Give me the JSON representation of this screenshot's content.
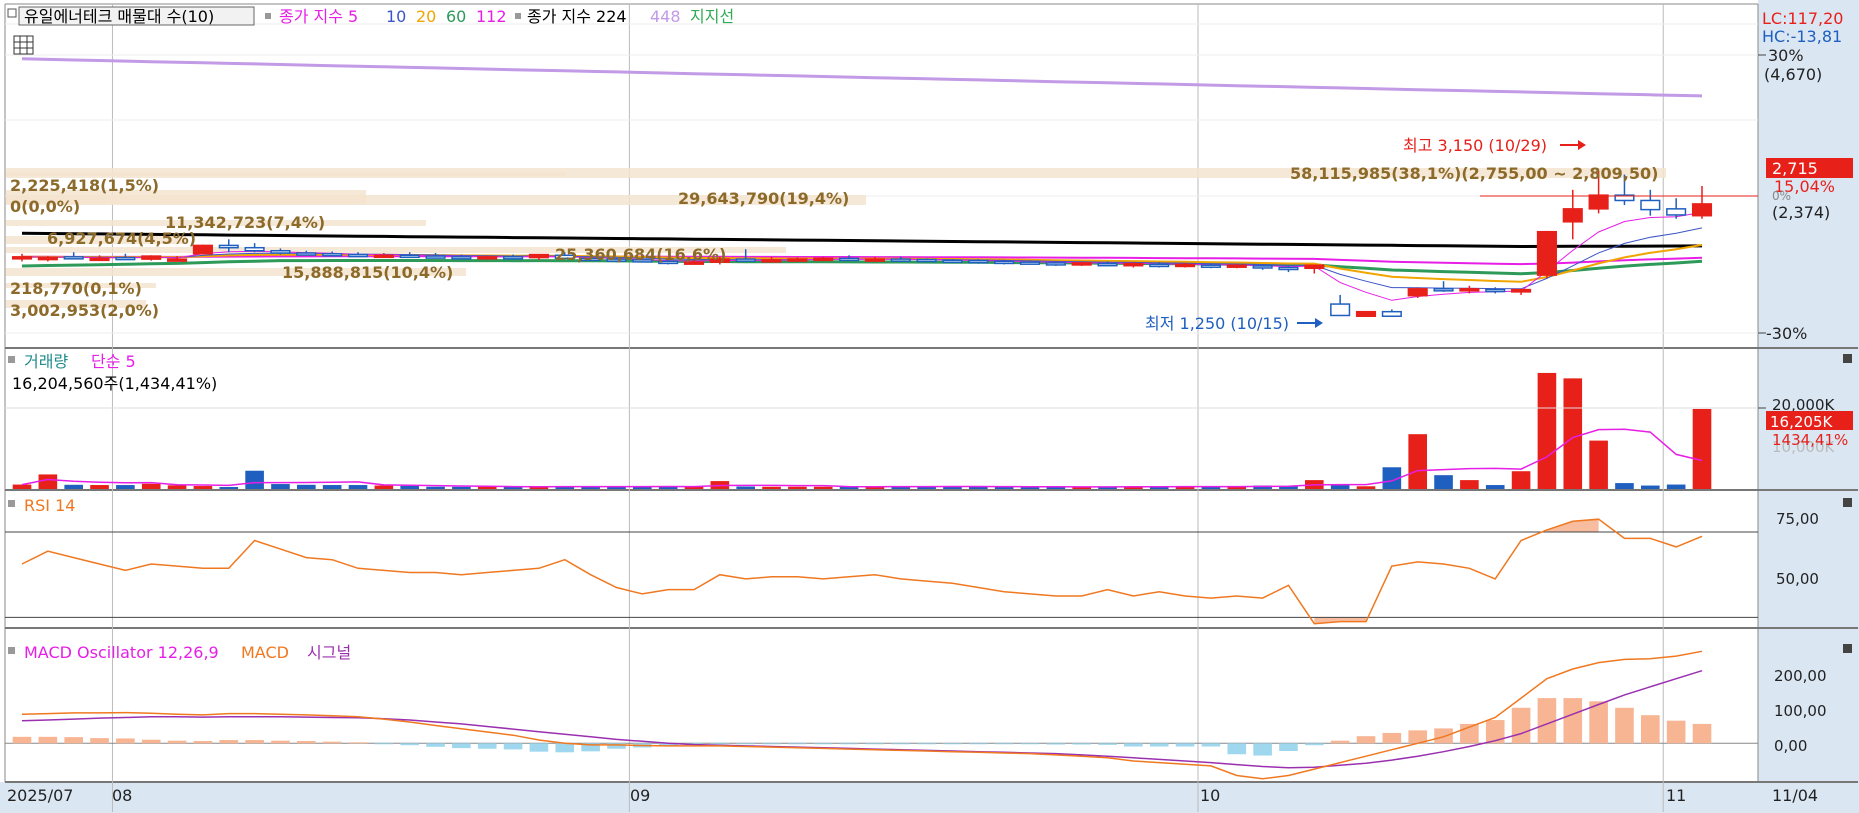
{
  "colors": {
    "up": "#e8201a",
    "down": "#1f5fbf",
    "ma5": "#e61ee6",
    "ma10": "#3b54c8",
    "ma20": "#f0a500",
    "ma60": "#2e9a5a",
    "ma112": "#e61ee6",
    "ma224": "#000000",
    "ma448": "#c29ae6",
    "support": "#33aa55",
    "volume_ma": "#e61ee6",
    "rsi": "#f07820",
    "macd": "#f07820",
    "signal": "#9a30b0",
    "osc_pos": "#f7b593",
    "osc_neg": "#9fd8ee",
    "volprofile_text": "#8c6a2a",
    "axis_bg": "#dbe6f3"
  },
  "legend": {
    "title": "유일에너테크 매물대 수(10)",
    "ma_label": "종가 지수 5",
    "ma10": "10",
    "ma20": "20",
    "ma60": "60",
    "ma112": "112",
    "ma2_label": "종가 지수 224",
    "ma448": "448",
    "support": "지지선"
  },
  "price_axis": {
    "lc": "LC:117,20",
    "hc": "HC:-13,81",
    "top_pct": "30%",
    "top_price": "(4,670)",
    "last_price": "2,715",
    "last_pct": "15,04%",
    "zero_pct": "0%",
    "base_price": "(2,374)",
    "bottom_pct": "-30%"
  },
  "price_annotations": {
    "high": "최고 3,150 (10/29)",
    "low": "최저 1,250 (10/15)"
  },
  "volume_profile": [
    {
      "text": "2,225,418(1,5%)"
    },
    {
      "text": "0(0,0%)"
    },
    {
      "text": "6,927,674(4,5%)"
    },
    {
      "text": "11,342,723(7,4%)"
    },
    {
      "text": "29,643,790(19,4%)"
    },
    {
      "text": "58,115,985(38,1%)(2,755,00 ~ 2,809,50)"
    },
    {
      "text": "25,360,684(16,6%)"
    },
    {
      "text": "15,888,815(10,4%)"
    },
    {
      "text": "218,770(0,1%)"
    },
    {
      "text": "3,002,953(2,0%)"
    }
  ],
  "volume_panel": {
    "title": "거래량",
    "ma_label": "단순 5",
    "summary": "16,204,560주(1,434,41%)",
    "axis_20000": "20,000K",
    "axis_last": "16,205K",
    "axis_pct": "1434,41%",
    "axis_hidden": "10,000K"
  },
  "rsi_panel": {
    "title": "RSI 14",
    "tick_75": "75,00",
    "tick_50": "50,00"
  },
  "macd_panel": {
    "osc_label": "MACD Oscillator 12,26,9",
    "macd_label": "MACD",
    "signal_label": "시그널",
    "tick_200": "200,00",
    "tick_100": "100,00",
    "tick_0": "0,00"
  },
  "x_axis": {
    "labels": [
      "2025/07",
      "08",
      "09",
      "10",
      "11"
    ],
    "right_label": "11/04"
  },
  "chart_data": {
    "type": "candlestick",
    "title": "유일에너테크",
    "dates": [
      "07/28",
      "07/29",
      "07/30",
      "07/31",
      "08/01",
      "08/04",
      "08/05",
      "08/06",
      "08/07",
      "08/08",
      "08/11",
      "08/12",
      "08/13",
      "08/14",
      "08/18",
      "08/19",
      "08/20",
      "08/21",
      "08/22",
      "08/25",
      "08/26",
      "08/27",
      "08/28",
      "08/29",
      "09/01",
      "09/02",
      "09/03",
      "09/04",
      "09/05",
      "09/08",
      "09/09",
      "09/10",
      "09/11",
      "09/12",
      "09/15",
      "09/16",
      "09/17",
      "09/18",
      "09/19",
      "09/22",
      "09/23",
      "09/24",
      "09/25",
      "09/26",
      "09/29",
      "09/30",
      "10/01",
      "10/02",
      "10/10",
      "10/13",
      "10/14",
      "10/15",
      "10/16",
      "10/17",
      "10/20",
      "10/21",
      "10/22",
      "10/23",
      "10/24",
      "10/27",
      "10/28",
      "10/29",
      "10/30",
      "10/31",
      "11/03",
      "11/04"
    ],
    "open": [
      2010,
      2000,
      2020,
      2000,
      2010,
      1990,
      1990,
      2060,
      2170,
      2140,
      2100,
      2070,
      2060,
      2050,
      2030,
      2040,
      2030,
      2020,
      2010,
      2020,
      2010,
      2040,
      2000,
      1990,
      1980,
      1960,
      1940,
      1950,
      1990,
      1980,
      1980,
      1990,
      2000,
      1990,
      1990,
      1985,
      1975,
      1970,
      1960,
      1950,
      1940,
      1930,
      1930,
      1920,
      1920,
      1910,
      1910,
      1900,
      1900,
      1880,
      1870,
      1400,
      1240,
      1300,
      1510,
      1600,
      1590,
      1590,
      1560,
      1780,
      2480,
      2650,
      2830,
      2760,
      2650,
      2560
    ],
    "high": [
      2060,
      2030,
      2080,
      2040,
      2060,
      2040,
      2030,
      2180,
      2250,
      2200,
      2130,
      2100,
      2090,
      2080,
      2070,
      2080,
      2070,
      2050,
      2040,
      2050,
      2040,
      2080,
      2030,
      2010,
      2000,
      2000,
      1980,
      2020,
      2120,
      2020,
      2010,
      2020,
      2040,
      2020,
      2020,
      2000,
      1990,
      1990,
      1980,
      1970,
      1960,
      1950,
      1960,
      1950,
      1950,
      1940,
      1930,
      1920,
      1920,
      1900,
      1910,
      1520,
      1300,
      1330,
      1620,
      1700,
      1640,
      1620,
      1600,
      2360,
      2900,
      3150,
      3100,
      2900,
      2790,
      2950
    ],
    "low": [
      1960,
      1960,
      1990,
      1980,
      1980,
      1970,
      1970,
      2050,
      2080,
      2080,
      2050,
      2040,
      2030,
      2020,
      2010,
      2010,
      2000,
      1990,
      1980,
      1990,
      1980,
      1990,
      1970,
      1950,
      1950,
      1920,
      1920,
      1920,
      1960,
      1960,
      1960,
      1970,
      1970,
      1970,
      1960,
      1950,
      1940,
      1930,
      1920,
      1920,
      1900,
      1900,
      1900,
      1880,
      1880,
      1880,
      1870,
      1870,
      1850,
      1820,
      1800,
      1250,
      1240,
      1240,
      1480,
      1560,
      1540,
      1540,
      1520,
      1740,
      2250,
      2590,
      2700,
      2560,
      2520,
      2520
    ],
    "close": [
      2020,
      2010,
      2010,
      2000,
      2000,
      2030,
      1990,
      2170,
      2140,
      2100,
      2070,
      2060,
      2050,
      2030,
      2040,
      2030,
      2020,
      2010,
      2020,
      2010,
      2050,
      2000,
      1990,
      1980,
      1960,
      1940,
      1950,
      1990,
      1970,
      1980,
      1990,
      2000,
      1990,
      1990,
      1985,
      1975,
      1970,
      1960,
      1950,
      1940,
      1930,
      1940,
      1920,
      1930,
      1910,
      1920,
      1900,
      1910,
      1880,
      1870,
      1910,
      1250,
      1300,
      1240,
      1600,
      1590,
      1600,
      1580,
      1590,
      2350,
      2650,
      2830,
      2760,
      2640,
      2570,
      2715
    ],
    "volume": [
      1000,
      900,
      2950,
      850,
      800,
      800,
      1050,
      750,
      600,
      400,
      3700,
      1000,
      850,
      800,
      800,
      700,
      650,
      450,
      450,
      450,
      450,
      450,
      600,
      450,
      450,
      450,
      600,
      450,
      1600,
      500,
      450,
      450,
      450,
      550,
      450,
      500,
      500,
      500,
      550,
      400,
      350,
      400,
      450,
      500,
      500,
      450,
      500,
      450,
      550,
      700,
      650,
      1800,
      800,
      550,
      4400,
      11100,
      2800,
      1800,
      800,
      3600,
      23500,
      22400,
      9800,
      1200,
      700,
      900,
      16205
    ],
    "rsi": [
      59,
      55,
      61,
      58,
      55,
      52,
      55,
      54,
      53,
      53,
      66,
      62,
      58,
      57,
      53,
      52,
      51,
      51,
      50,
      51,
      52,
      53,
      57,
      50,
      44,
      41,
      43,
      43,
      50,
      48,
      49,
      49,
      48,
      49,
      50,
      48,
      47,
      46,
      44,
      42,
      41,
      40,
      40,
      43,
      40,
      42,
      40,
      39,
      40,
      39,
      45,
      27,
      28,
      28,
      54,
      56,
      55,
      53,
      48,
      66,
      71,
      75,
      76,
      67,
      67,
      63,
      68
    ],
    "macd": [
      90,
      92,
      94,
      94,
      95,
      93,
      90,
      88,
      92,
      92,
      90,
      88,
      85,
      82,
      75,
      66,
      55,
      45,
      35,
      25,
      10,
      0,
      -5,
      -5,
      -7,
      -8,
      -8,
      -8,
      -10,
      -12,
      -14,
      -16,
      -18,
      -20,
      -22,
      -24,
      -26,
      -28,
      -30,
      -32,
      -36,
      -40,
      -45,
      -55,
      -60,
      -65,
      -70,
      -100,
      -110,
      -100,
      -80,
      -60,
      -40,
      -20,
      0,
      20,
      50,
      80,
      140,
      200,
      230,
      250,
      260,
      262,
      270,
      285
    ],
    "signal": [
      70,
      72,
      75,
      78,
      80,
      82,
      82,
      81,
      82,
      82,
      82,
      81,
      80,
      79,
      76,
      72,
      66,
      60,
      52,
      44,
      36,
      28,
      20,
      12,
      6,
      0,
      -4,
      -6,
      -8,
      -10,
      -12,
      -14,
      -16,
      -18,
      -20,
      -22,
      -24,
      -26,
      -28,
      -30,
      -32,
      -36,
      -40,
      -45,
      -50,
      -55,
      -60,
      -66,
      -72,
      -76,
      -74,
      -68,
      -62,
      -52,
      -40,
      -26,
      -10,
      8,
      30,
      60,
      90,
      120,
      150,
      175,
      200,
      225
    ],
    "ylim_price": [
      1020,
      4670
    ],
    "rsi_ylim": [
      25,
      85
    ],
    "macd_ylim": [
      -120,
      320
    ]
  }
}
